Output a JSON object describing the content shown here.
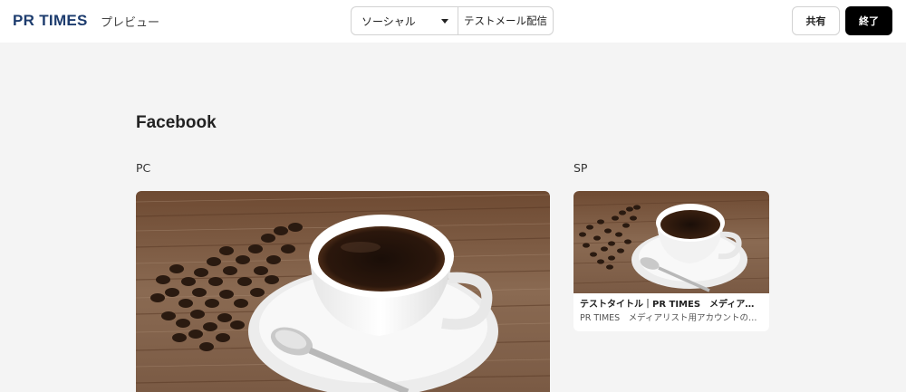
{
  "header": {
    "logo": "PR TIMES",
    "title": "プレビュー",
    "select_value": "ソーシャル",
    "test_mail_label": "テストメール配信",
    "share_label": "共有",
    "end_label": "終了"
  },
  "main": {
    "section_title": "Facebook",
    "pc_label": "PC",
    "sp_label": "SP",
    "sp_card": {
      "title": "テストタイトル｜PR TIMES　メディアリスト用アカウントのテスト",
      "description": "PR TIMES　メディアリスト用アカウントのテスト配信です"
    }
  },
  "colors": {
    "logo": "#1d3c6e",
    "background": "#f4f4f4",
    "end_button": "#000000"
  }
}
